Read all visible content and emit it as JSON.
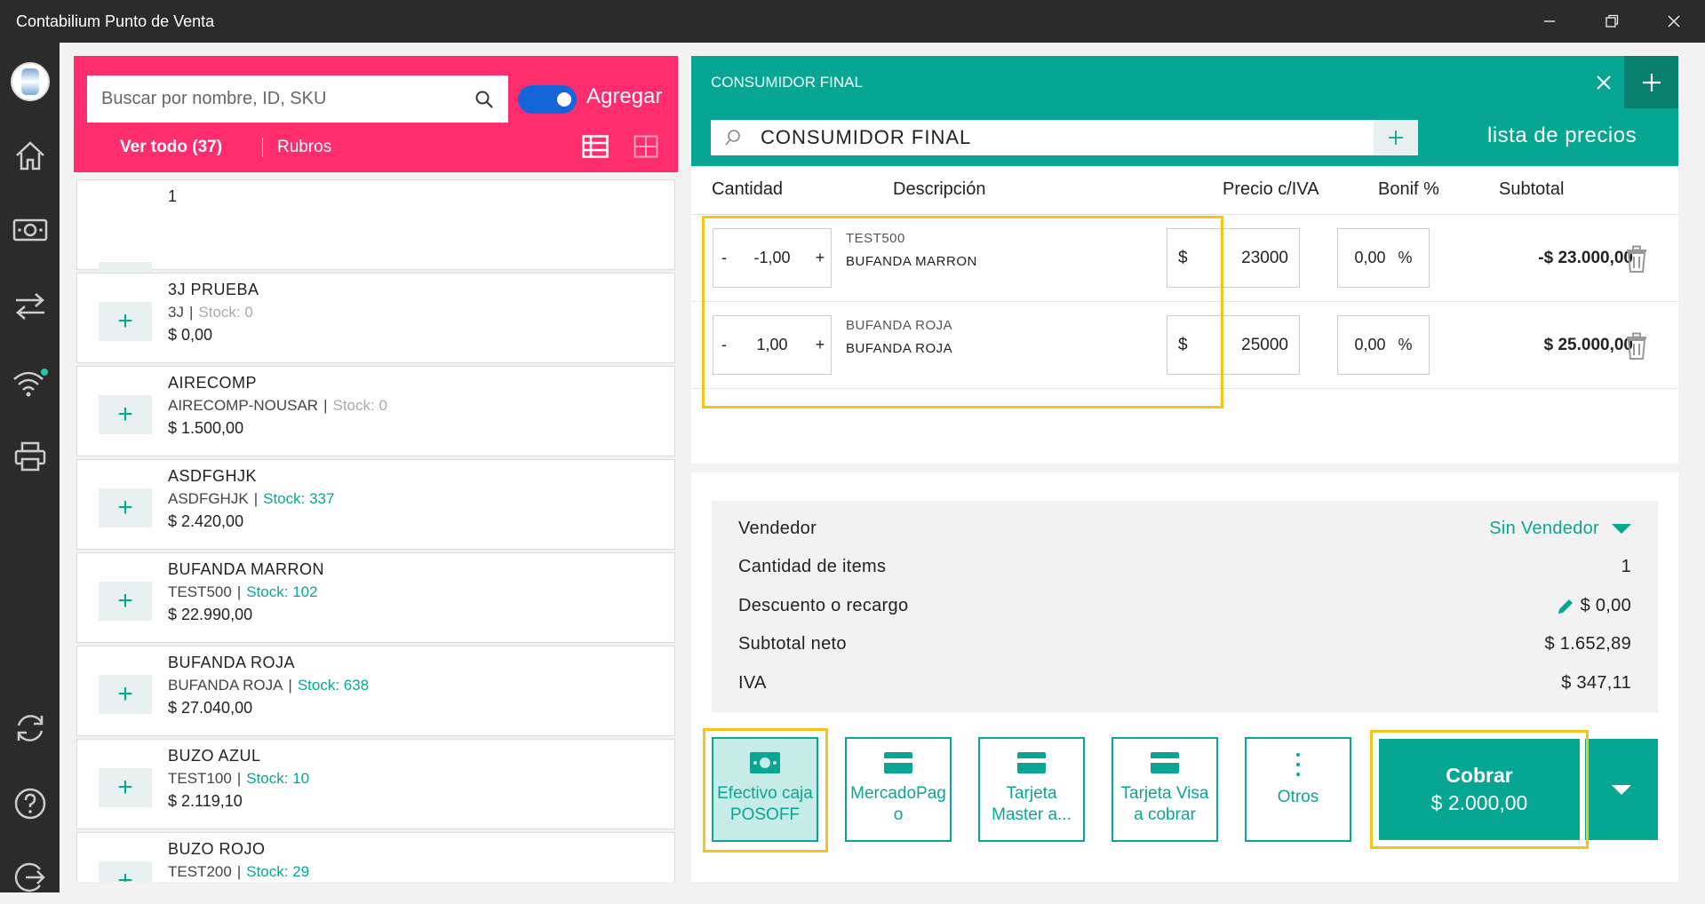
{
  "window": {
    "title": "Contabilium Punto de Venta"
  },
  "left": {
    "search_placeholder": "Buscar por nombre, ID, SKU",
    "toggle_label": "Agregar",
    "filter_all": "Ver todo (37)",
    "filter_rubros": "Rubros"
  },
  "products": [
    {
      "name": "1",
      "code": "",
      "stock": "",
      "price": ""
    },
    {
      "name": "3J PRUEBA",
      "code": "3J",
      "stock": "Stock: 0",
      "price": "$ 0,00"
    },
    {
      "name": "AIRECOMP",
      "code": "AIRECOMP-NOUSAR",
      "stock": "Stock: 0",
      "price": "$ 1.500,00"
    },
    {
      "name": "ASDFGHJK",
      "code": "ASDFGHJK",
      "stock": "Stock: 337",
      "price": "$ 2.420,00"
    },
    {
      "name": "BUFANDA MARRON",
      "code": "TEST500",
      "stock": "Stock: 102",
      "price": "$ 22.990,00"
    },
    {
      "name": "BUFANDA ROJA",
      "code": "BUFANDA ROJA",
      "stock": "Stock: 638",
      "price": "$ 27.040,00"
    },
    {
      "name": "BUZO AZUL",
      "code": "TEST100",
      "stock": "Stock: 10",
      "price": "$ 2.119,10"
    },
    {
      "name": "BUZO ROJO",
      "code": "TEST200",
      "stock": "Stock: 29",
      "price": ""
    }
  ],
  "customer": {
    "header_label": "CONSUMIDOR FINAL",
    "search_value": "CONSUMIDOR FINAL",
    "price_list_label": "lista de precios"
  },
  "cart": {
    "columns": {
      "qty": "Cantidad",
      "desc": "Descripción",
      "price": "Precio c/IVA",
      "bonif": "Bonif %",
      "subtotal": "Subtotal"
    },
    "rows": [
      {
        "qty": "-1,00",
        "code": "TEST500",
        "desc": "BUFANDA MARRON",
        "currency": "$",
        "price": "23000",
        "bonif": "0,00",
        "pct": "%",
        "subtotal": "-$ 23.000,00"
      },
      {
        "qty": "1,00",
        "code": "BUFANDA ROJA",
        "desc": "BUFANDA ROJA",
        "currency": "$",
        "price": "25000",
        "bonif": "0,00",
        "pct": "%",
        "subtotal": "$ 25.000,00"
      }
    ],
    "minus": "-",
    "plus": "+"
  },
  "summary": {
    "vendedor_label": "Vendedor",
    "vendedor_value": "Sin Vendedor",
    "items_label": "Cantidad de items",
    "items_value": "1",
    "discount_label": "Descuento o recargo",
    "discount_value": "$ 0,00",
    "neto_label": "Subtotal neto",
    "neto_value": "$ 1.652,89",
    "iva_label": "IVA",
    "iva_value": "$ 347,11"
  },
  "payment": {
    "methods": [
      {
        "line1": "Efectivo caja",
        "line2": "POSOFF"
      },
      {
        "line1": "MercadoPag",
        "line2": "o"
      },
      {
        "line1": "Tarjeta",
        "line2": "Master a..."
      },
      {
        "line1": "Tarjeta Visa",
        "line2": "a cobrar"
      },
      {
        "line1": "Otros",
        "line2": ""
      }
    ],
    "cobrar_label": "Cobrar",
    "cobrar_amount": "$ 2.000,00"
  },
  "colors": {
    "accent": "#07a692",
    "pink": "#ff2d6e",
    "highlight": "#f7c21a",
    "toggle": "#1565d8"
  }
}
